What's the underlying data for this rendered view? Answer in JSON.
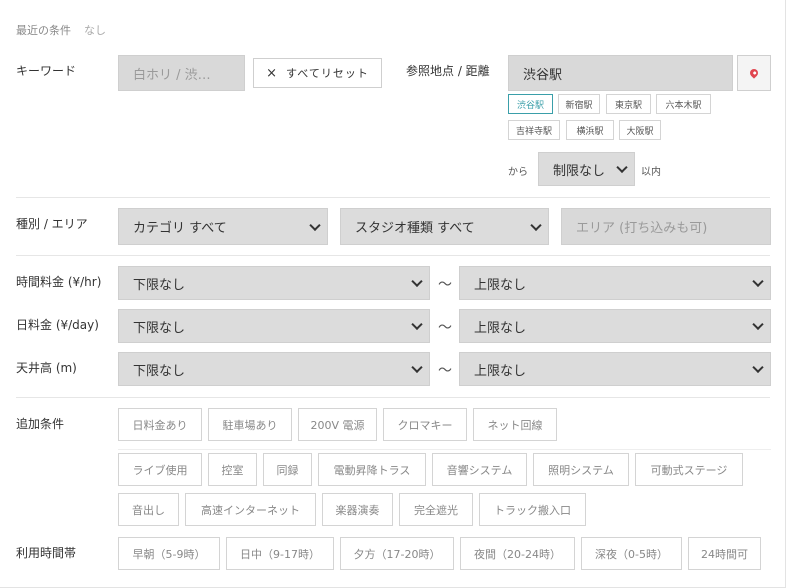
{
  "recent": {
    "label": "最近の条件",
    "value": "なし"
  },
  "keyword": {
    "label": "キーワード",
    "placeholder": "白ホリ / 渋…",
    "reset_label": "すべてリセット",
    "reset_icon": "×"
  },
  "reference": {
    "label": "参照地点 / 距離",
    "value": "渋谷駅",
    "pin_icon": "map-pin-icon",
    "pin_color": "#e0454f",
    "stations": [
      "渋谷駅",
      "新宿駅",
      "東京駅",
      "六本木駅",
      "吉祥寺駅",
      "横浜駅",
      "大阪駅"
    ],
    "active_station": "渋谷駅",
    "active_color": "#3a9fa9",
    "distance_prefix": "から",
    "distance_value": "制限なし",
    "distance_suffix": "以内"
  },
  "category": {
    "label": "種別 / エリア",
    "category_select": "カテゴリ すべて",
    "studio_select": "スタジオ種類 すべて",
    "area_placeholder": "エリア (打ち込みも可)"
  },
  "price_rows": [
    {
      "label": "時間料金 (¥/hr)",
      "min": "下限なし",
      "max": "上限なし",
      "sep": "〜"
    },
    {
      "label": "日料金 (¥/day)",
      "min": "下限なし",
      "max": "上限なし",
      "sep": "〜"
    },
    {
      "label": "天井高 (m)",
      "min": "下限なし",
      "max": "上限なし",
      "sep": "〜"
    }
  ],
  "extras": {
    "label": "追加条件",
    "row1": [
      "日料金あり",
      "駐車場あり",
      "200V 電源",
      "クロマキー",
      "ネット回線"
    ],
    "row2": [
      "ライブ使用",
      "控室",
      "同録",
      "電動昇降トラス",
      "音響システム",
      "照明システム",
      "可動式ステージ"
    ],
    "row3": [
      "音出し",
      "高速インターネット",
      "楽器演奏",
      "完全遮光",
      "トラック搬入口"
    ]
  },
  "time_slots": {
    "label": "利用時間帯",
    "items": [
      "早朝（5-9時）",
      "日中（9-17時）",
      "夕方（17-20時）",
      "夜間（20-24時）",
      "深夜（0-5時）",
      "24時間可"
    ]
  }
}
